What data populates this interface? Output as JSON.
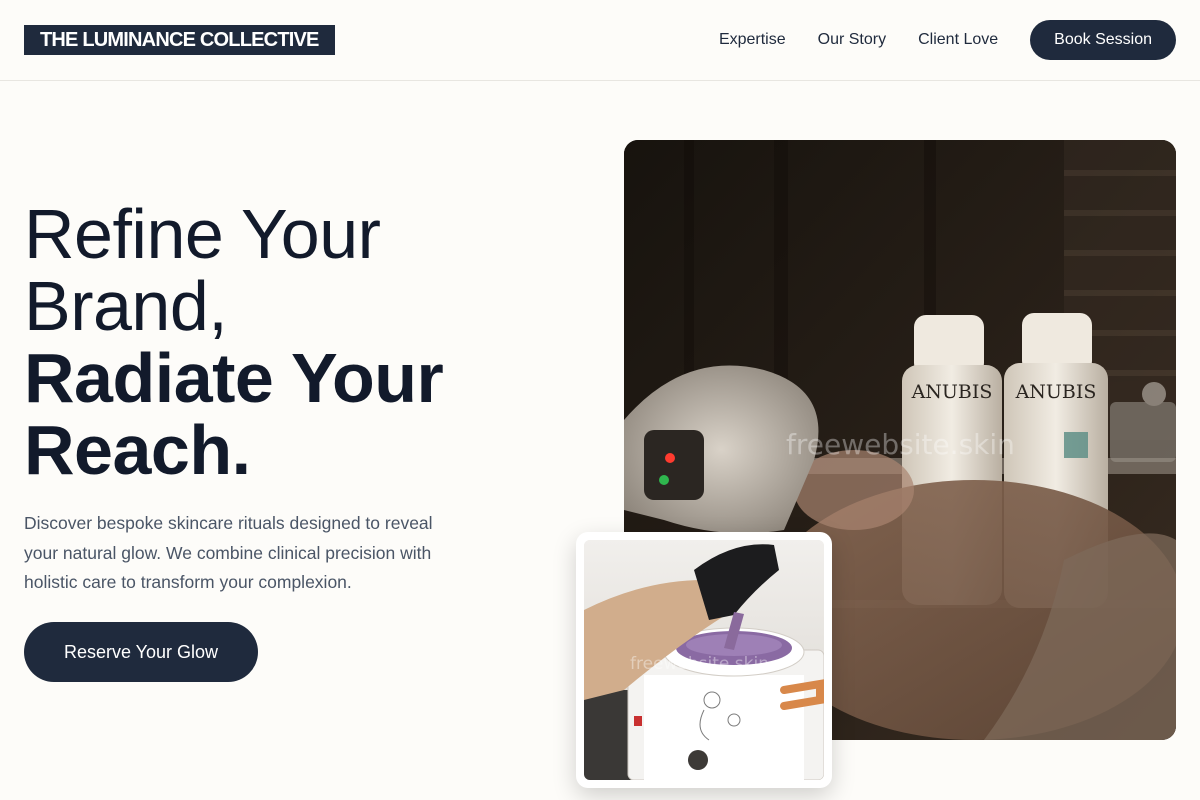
{
  "brand": {
    "name": "THE LUMINANCE COLLECTIVE"
  },
  "nav": {
    "links": [
      "Expertise",
      "Our Story",
      "Client Love"
    ],
    "cta_label": "Book Session"
  },
  "hero": {
    "title_line1": "Refine Your",
    "title_line2": "Brand,",
    "title_line3": "Radiate Your",
    "title_line4": "Reach.",
    "description": "Discover bespoke skincare rituals designed to reveal your natural glow. We combine clinical precision with holistic care to transform your complexion.",
    "cta_label": "Reserve Your Glow"
  },
  "images": {
    "main": {
      "product_label": "ANUBIS",
      "watermark": "freewebsite.skin"
    },
    "inset": {
      "watermark": "freewebsite.skin"
    }
  },
  "colors": {
    "primary": "#1f2a3d",
    "background": "#fdfcf9",
    "text_muted": "#4a5566"
  }
}
